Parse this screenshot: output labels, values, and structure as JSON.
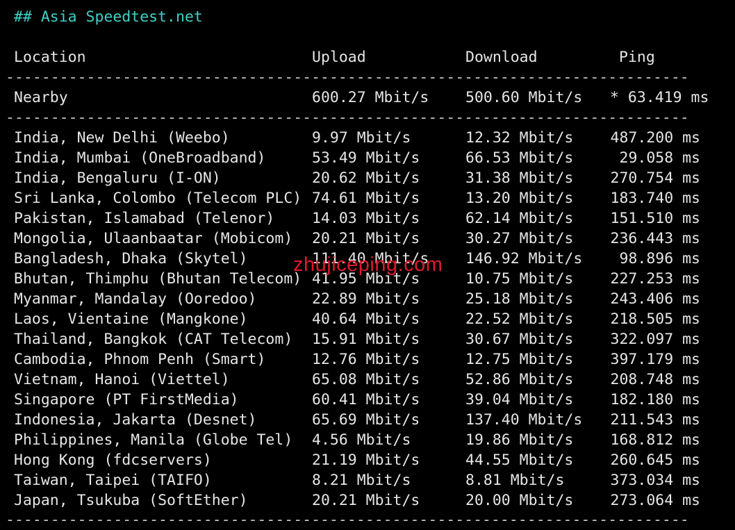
{
  "title": "## Asia Speedtest.net",
  "headers": {
    "location": "Location",
    "upload": "Upload",
    "download": "Download",
    "ping": "Ping"
  },
  "separator": "----------------------------------------------------------------------------",
  "nearby": {
    "location": "Nearby",
    "upload": "600.27 Mbit/s",
    "download": "500.60 Mbit/s",
    "ping": "* 63.419 ms"
  },
  "rows": [
    {
      "location": "India, New Delhi (Weebo)",
      "upload": "9.97 Mbit/s",
      "download": "12.32 Mbit/s",
      "ping": "487.200 ms"
    },
    {
      "location": "India, Mumbai (OneBroadband)",
      "upload": "53.49 Mbit/s",
      "download": "66.53 Mbit/s",
      "ping": "29.058 ms"
    },
    {
      "location": "India, Bengaluru (I-ON)",
      "upload": "20.62 Mbit/s",
      "download": "31.38 Mbit/s",
      "ping": "270.754 ms"
    },
    {
      "location": "Sri Lanka, Colombo (Telecom PLC)",
      "upload": "74.61 Mbit/s",
      "download": "13.20 Mbit/s",
      "ping": "183.740 ms"
    },
    {
      "location": "Pakistan, Islamabad (Telenor)",
      "upload": "14.03 Mbit/s",
      "download": "62.14 Mbit/s",
      "ping": "151.510 ms"
    },
    {
      "location": "Mongolia, Ulaanbaatar (Mobicom)",
      "upload": "20.21 Mbit/s",
      "download": "30.27 Mbit/s",
      "ping": "236.443 ms"
    },
    {
      "location": "Bangladesh, Dhaka (Skytel)",
      "upload": "111.40 Mbit/s",
      "download": "146.92 Mbit/s",
      "ping": "98.896 ms"
    },
    {
      "location": "Bhutan, Thimphu (Bhutan Telecom)",
      "upload": "41.95 Mbit/s",
      "download": "10.75 Mbit/s",
      "ping": "227.253 ms"
    },
    {
      "location": "Myanmar, Mandalay (Ooredoo)",
      "upload": "22.89 Mbit/s",
      "download": "25.18 Mbit/s",
      "ping": "243.406 ms"
    },
    {
      "location": "Laos, Vientaine (Mangkone)",
      "upload": "40.64 Mbit/s",
      "download": "22.52 Mbit/s",
      "ping": "218.505 ms"
    },
    {
      "location": "Thailand, Bangkok (CAT Telecom)",
      "upload": "15.91 Mbit/s",
      "download": "30.67 Mbit/s",
      "ping": "322.097 ms"
    },
    {
      "location": "Cambodia, Phnom Penh (Smart)",
      "upload": "12.76 Mbit/s",
      "download": "12.75 Mbit/s",
      "ping": "397.179 ms"
    },
    {
      "location": "Vietnam, Hanoi (Viettel)",
      "upload": "65.08 Mbit/s",
      "download": "52.86 Mbit/s",
      "ping": "208.748 ms"
    },
    {
      "location": "Singapore (PT FirstMedia)",
      "upload": "60.41 Mbit/s",
      "download": "39.04 Mbit/s",
      "ping": "182.180 ms"
    },
    {
      "location": "Indonesia, Jakarta (Desnet)",
      "upload": "65.69 Mbit/s",
      "download": "137.40 Mbit/s",
      "ping": "211.543 ms"
    },
    {
      "location": "Philippines, Manila (Globe Tel)",
      "upload": "4.56 Mbit/s",
      "download": "19.86 Mbit/s",
      "ping": "168.812 ms"
    },
    {
      "location": "Hong Kong (fdcservers)",
      "upload": "21.19 Mbit/s",
      "download": "44.55 Mbit/s",
      "ping": "260.645 ms"
    },
    {
      "location": "Taiwan, Taipei (TAIFO)",
      "upload": "8.21 Mbit/s",
      "download": "8.81 Mbit/s",
      "ping": "373.034 ms"
    },
    {
      "location": "Japan, Tsukuba (SoftEther)",
      "upload": "20.21 Mbit/s",
      "download": "20.00 Mbit/s",
      "ping": "273.064 ms"
    }
  ],
  "watermark": "zhujiceping.com",
  "colors": {
    "background": "#000000",
    "text": "#e6e6e6",
    "title": "#3fd2c7",
    "watermark": "#e0192a"
  }
}
